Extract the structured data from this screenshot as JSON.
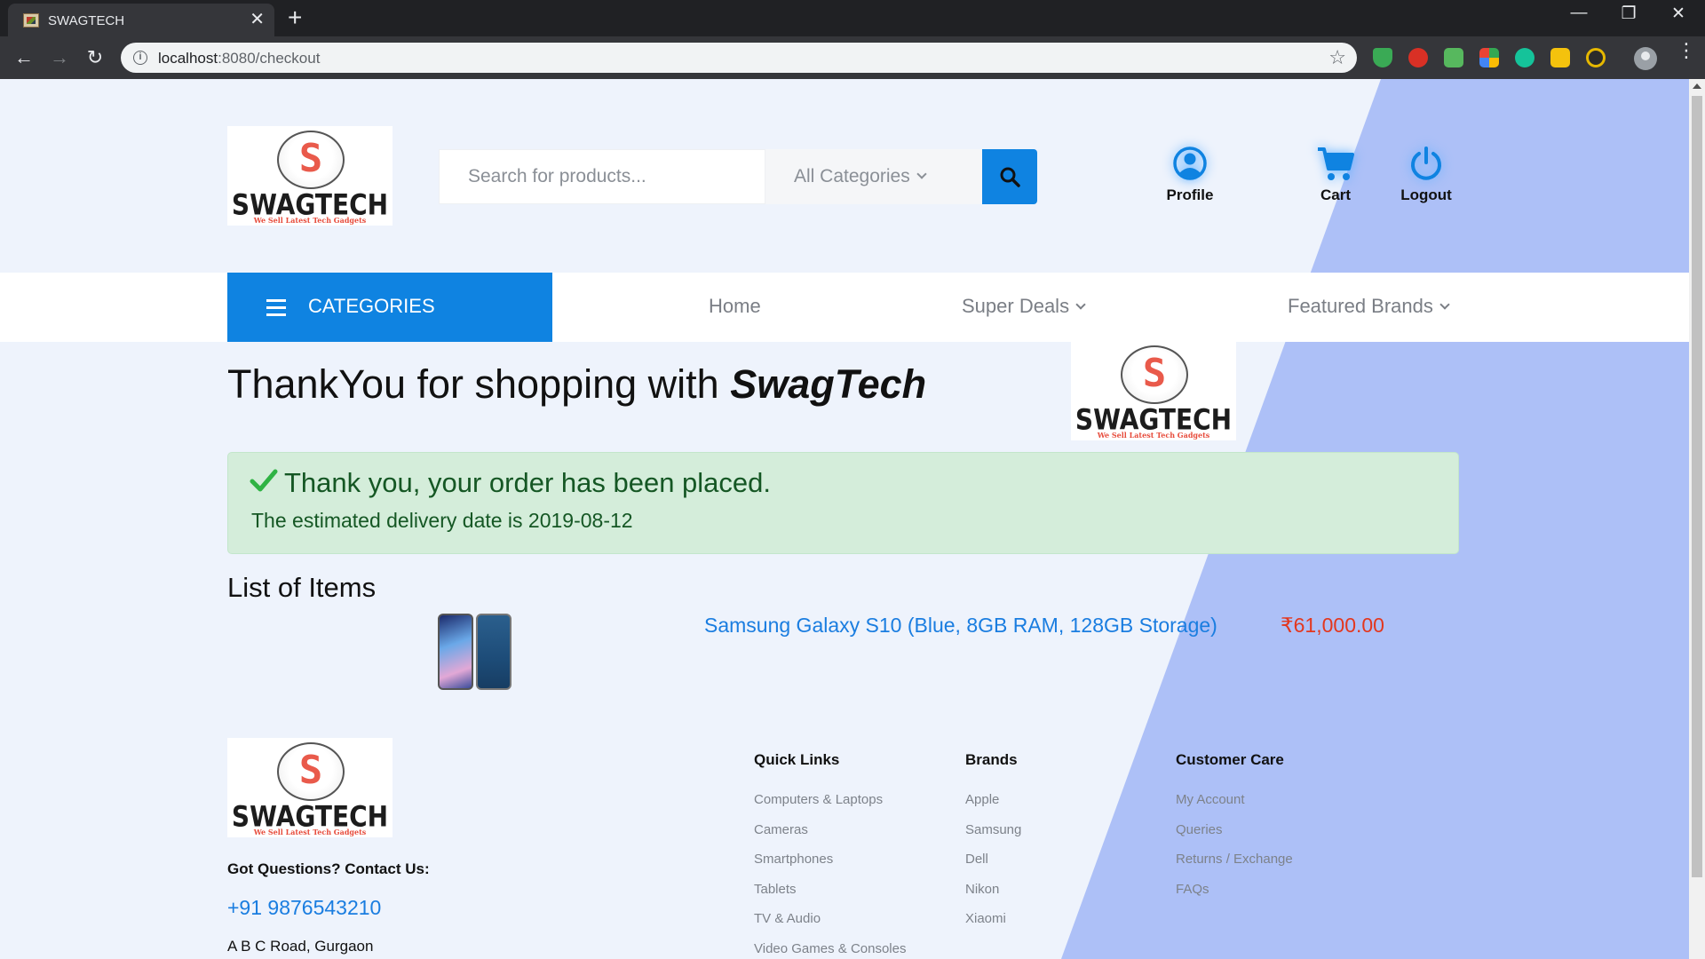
{
  "browser": {
    "tab_title": "SWAGTECH",
    "tab_close": "✕",
    "new_tab": "+",
    "url_host": "localhost",
    "url_path": ":8080/checkout",
    "back": "←",
    "forward": "→",
    "reload": "↻",
    "star": "☆",
    "minimize": "—",
    "restore": "❐",
    "close": "✕",
    "menu": "⋮",
    "info": "i"
  },
  "header": {
    "logo_letter": "S",
    "logo_name": "SWAGTECH",
    "logo_tagline": "We Sell Latest Tech Gadgets",
    "search_placeholder": "Search for products...",
    "category_select": "All Categories",
    "actions": [
      {
        "label": "Profile",
        "icon": "user-circle-icon"
      },
      {
        "label": "Cart",
        "icon": "cart-icon"
      },
      {
        "label": "Logout",
        "icon": "power-icon"
      }
    ]
  },
  "nav": {
    "categories_label": "CATEGORIES",
    "links": [
      "Home",
      "Super Deals",
      "Featured Brands"
    ]
  },
  "main": {
    "thank_title": "ThankYou for shopping with ",
    "thank_brand": "SwagTech",
    "alert_title": "Thank you, your order has been placed.",
    "alert_sub": "The estimated delivery date is 2019-08-12",
    "list_heading": "List of Items",
    "items": [
      {
        "name": "Samsung Galaxy S10 (Blue, 8GB RAM, 128GB Storage)",
        "price": "₹61,000.00"
      }
    ]
  },
  "footer": {
    "contact_question": "Got Questions? Contact Us:",
    "phone": "+91 9876543210",
    "address": "A B C Road, Gurgaon",
    "columns": [
      {
        "heading": "Quick Links",
        "links": [
          "Computers & Laptops",
          "Cameras",
          "Smartphones",
          "Tablets",
          "TV & Audio",
          "Video Games & Consoles"
        ]
      },
      {
        "heading": "Brands",
        "links": [
          "Apple",
          "Samsung",
          "Dell",
          "Nikon",
          "Xiaomi"
        ]
      },
      {
        "heading": "Customer Care",
        "links": [
          "My Account",
          "Queries",
          "Returns / Exchange",
          "FAQs"
        ]
      }
    ]
  },
  "colors": {
    "primary": "#0f83e1",
    "background": "#eef3fc",
    "diagonal": "#adc0f7",
    "success_bg": "#d4edda",
    "success_text": "#155724",
    "price": "#e3371e"
  }
}
